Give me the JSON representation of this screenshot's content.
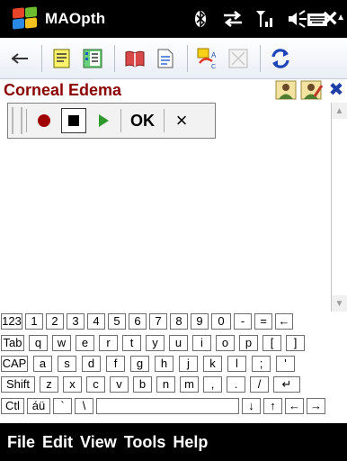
{
  "window": {
    "title": "MAOpth"
  },
  "status_bar": {
    "icons": [
      "bluetooth-icon",
      "sync-arrows-icon",
      "signal-icon",
      "volume-icon",
      "close-icon"
    ],
    "close_label": "×"
  },
  "toolbar": {
    "icons": [
      "back-icon",
      "notes-icon",
      "list-icon",
      "book-icon",
      "document-icon",
      "abc-link-icon",
      "fullscreen-icon",
      "refresh-icon"
    ]
  },
  "page": {
    "title": "Corneal Edema",
    "header_icons": [
      "user-profile-icon",
      "user-edit-icon",
      "close-x-icon"
    ],
    "header_close": "✖"
  },
  "media_bar": {
    "ok_label": "OK",
    "cancel_label": "×"
  },
  "keyboard": {
    "rows": [
      [
        "123",
        "1",
        "2",
        "3",
        "4",
        "5",
        "6",
        "7",
        "8",
        "9",
        "0",
        "-",
        "=",
        "←"
      ],
      [
        "Tab",
        "q",
        "w",
        "e",
        "r",
        "t",
        "y",
        "u",
        "i",
        "o",
        "p",
        "[",
        "]"
      ],
      [
        "CAP",
        "a",
        "s",
        "d",
        "f",
        "g",
        "h",
        "j",
        "k",
        "l",
        ";",
        "'"
      ],
      [
        "Shift",
        "z",
        "x",
        "c",
        "v",
        "b",
        "n",
        "m",
        ",",
        ".",
        "/",
        "↵"
      ],
      [
        "Ctl",
        "áü",
        "`",
        "\\",
        "",
        "↓",
        "↑",
        "←",
        "→"
      ]
    ]
  },
  "menu_bar": {
    "items": [
      "File",
      "Edit",
      "View",
      "Tools",
      "Help"
    ]
  },
  "colors": {
    "title_red": "#8b0000",
    "bar_black": "#000000"
  }
}
